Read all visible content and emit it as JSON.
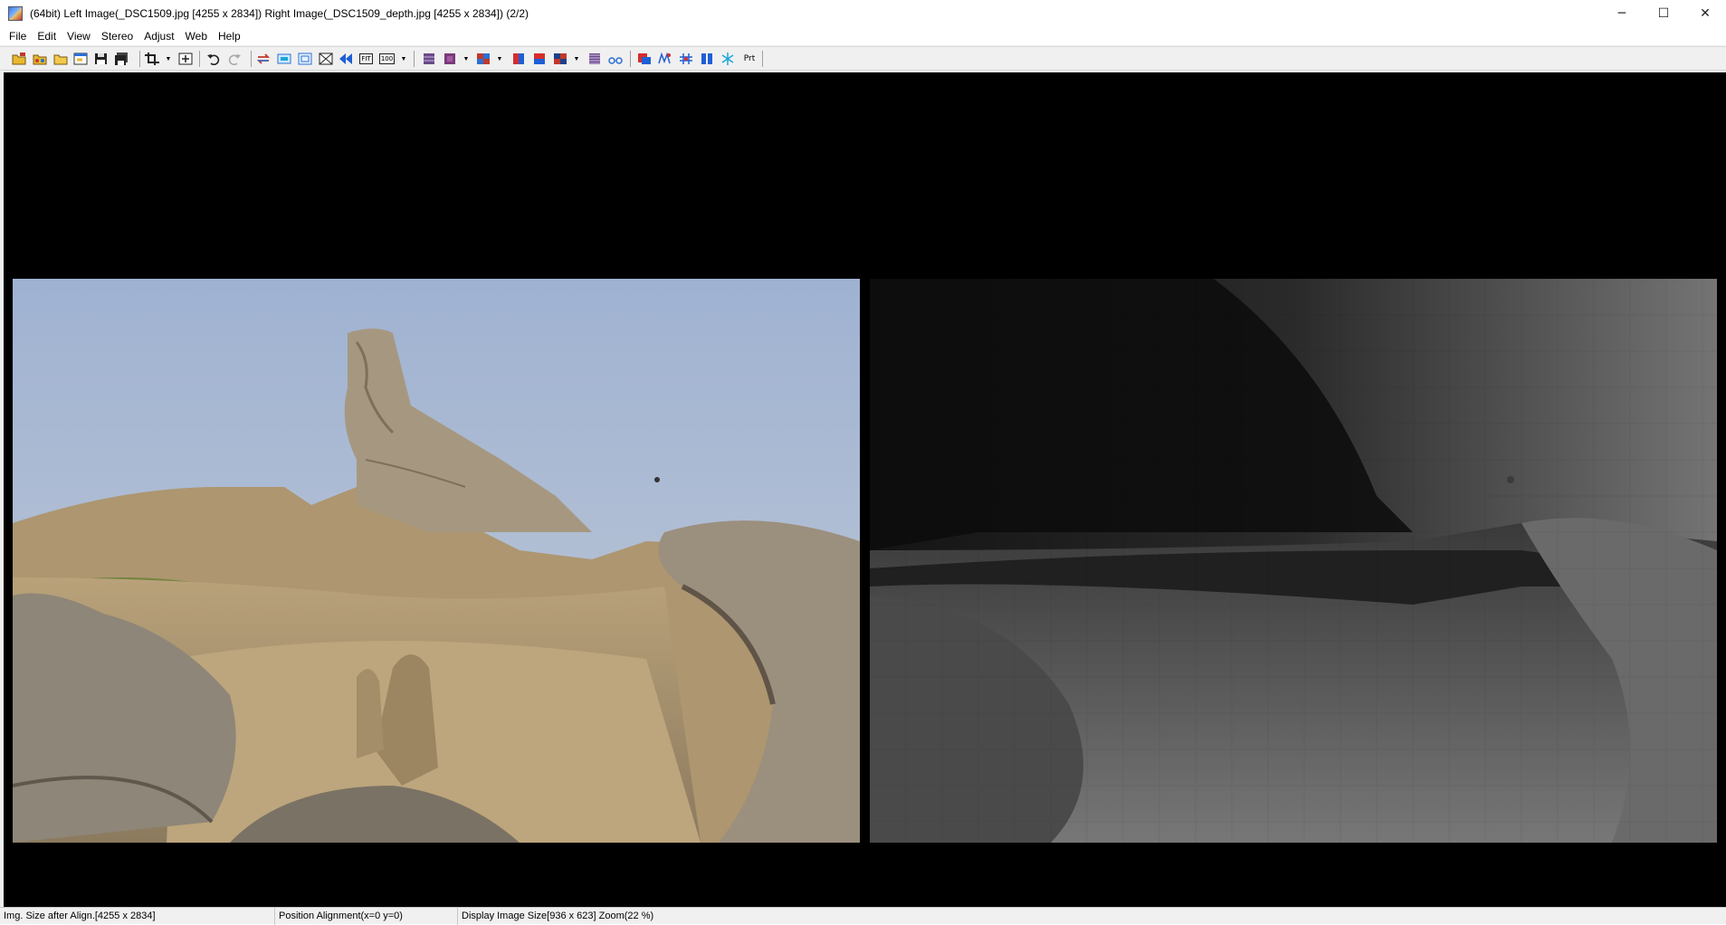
{
  "window": {
    "title": "(64bit) Left Image(_DSC1509.jpg [4255 x 2834]) Right Image(_DSC1509_depth.jpg [4255 x 2834])  (2/2)",
    "controls": {
      "minimize": "─",
      "maximize": "☐",
      "close": "✕"
    }
  },
  "menu": {
    "items": [
      "File",
      "Edit",
      "View",
      "Stereo",
      "Adjust",
      "Web",
      "Help"
    ]
  },
  "toolbar": {
    "print_label": "Prt",
    "fit_label": "FIT",
    "fullsize_label": "100"
  },
  "images": {
    "left": {
      "file": "_DSC1509.jpg",
      "width": 4255,
      "height": 2834
    },
    "right": {
      "file": "_DSC1509_depth.jpg",
      "width": 4255,
      "height": 2834
    }
  },
  "status": {
    "img_size": "Img. Size after Align.[4255 x 2834]",
    "position": "Position Alignment(x=0 y=0)",
    "display": "Display Image Size[936 x 623]  Zoom(22 %)"
  },
  "colors": {
    "viewport_bg": "#000000",
    "window_bg": "#f0f0f0"
  }
}
